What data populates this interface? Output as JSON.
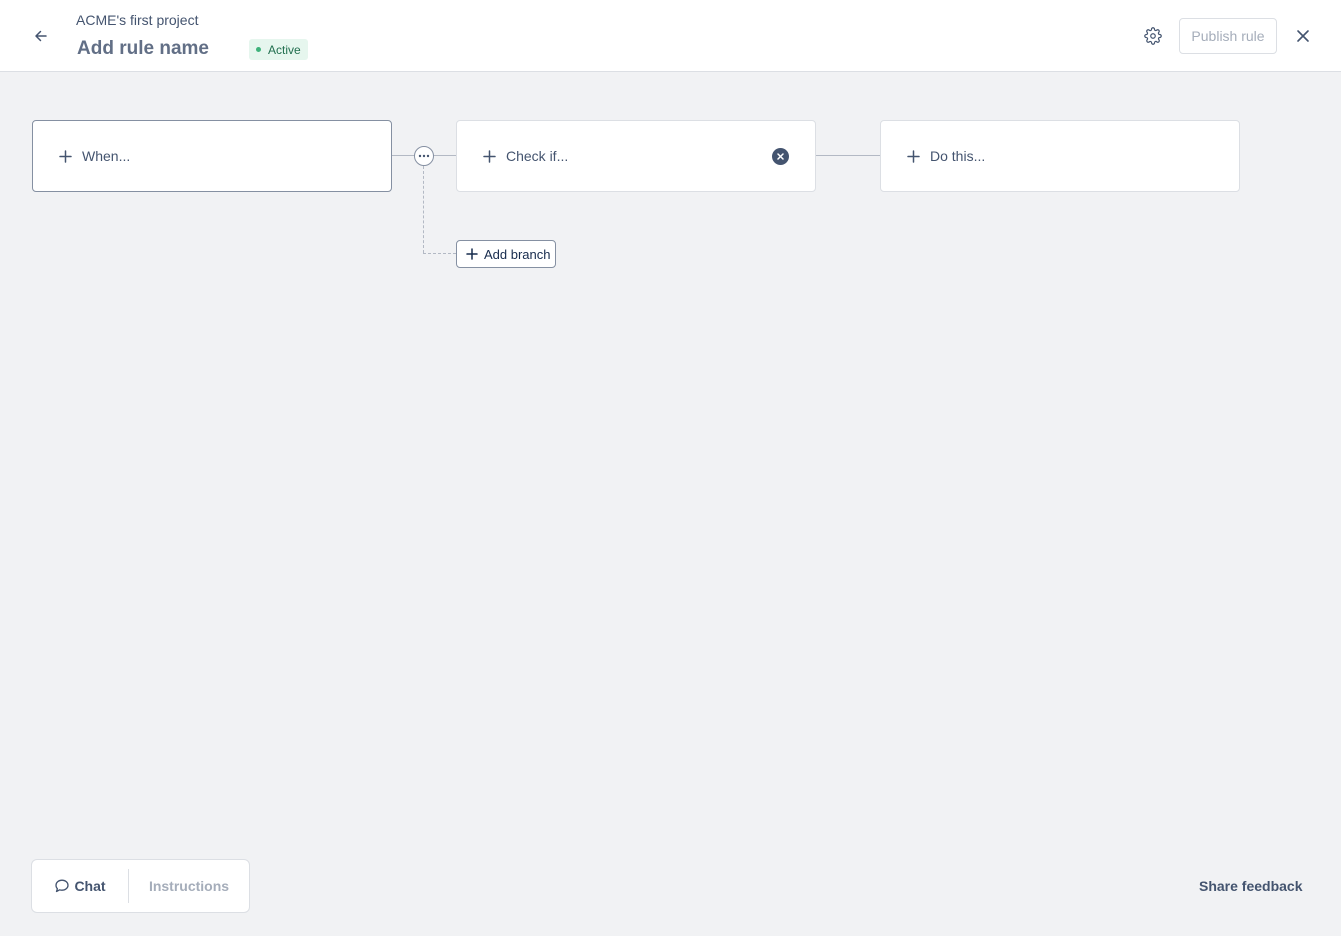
{
  "header": {
    "project_name": "ACME's first project",
    "rule_name": "Add rule name",
    "status": "Active",
    "publish_label": "Publish rule"
  },
  "flow": {
    "when_label": "When...",
    "check_label": "Check if...",
    "do_label": "Do this...",
    "add_branch_label": "Add branch"
  },
  "footer": {
    "chat_label": "Chat",
    "instructions_label": "Instructions",
    "share_feedback_label": "Share feedback"
  },
  "colors": {
    "status_green": "#3eb27b",
    "background": "#f1f2f4",
    "text": "#44546f"
  },
  "icons": [
    "arrow-left-icon",
    "gear-icon",
    "close-icon",
    "plus-icon",
    "clear-icon",
    "more-icon",
    "chat-bubble-icon"
  ]
}
